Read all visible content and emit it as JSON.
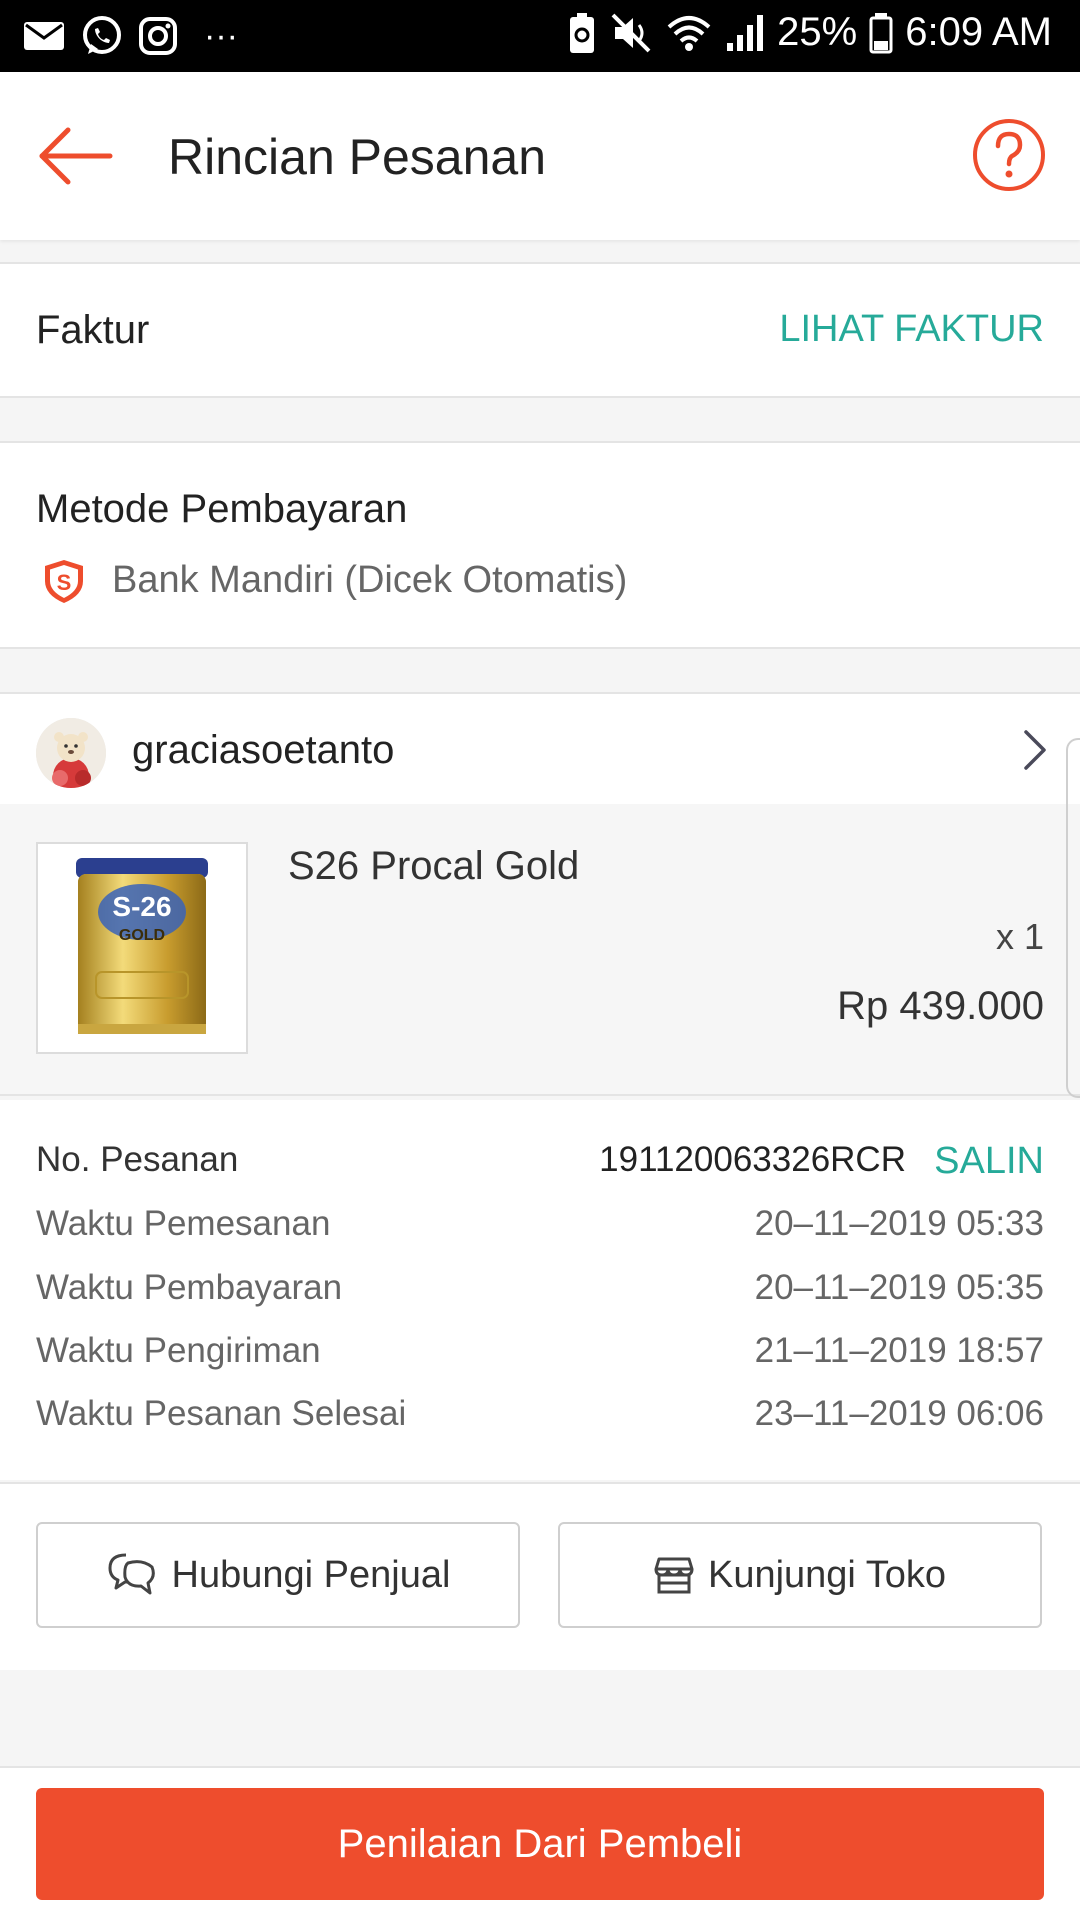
{
  "status_bar": {
    "battery": "25%",
    "time": "6:09 AM",
    "overflow": "···"
  },
  "header": {
    "title": "Rincian Pesanan"
  },
  "invoice": {
    "label": "Faktur",
    "action": "LIHAT FAKTUR"
  },
  "payment": {
    "label": "Metode Pembayaran",
    "method": "Bank Mandiri (Dicek Otomatis)"
  },
  "shop": {
    "name": "graciasoetanto"
  },
  "product": {
    "name": "S26 Procal Gold",
    "quantity": "x 1",
    "price": "Rp 439.000",
    "image_text_brand": "S-26",
    "image_text_sub": "GOLD"
  },
  "order_details": {
    "order_no_label": "No. Pesanan",
    "order_no": "191120063326RCR",
    "copy_label": "SALIN",
    "rows": [
      {
        "label": "Waktu Pemesanan",
        "value": "20–11–2019 05:33"
      },
      {
        "label": "Waktu Pembayaran",
        "value": "20–11–2019 05:35"
      },
      {
        "label": "Waktu Pengiriman",
        "value": "21–11–2019 18:57"
      },
      {
        "label": "Waktu Pesanan Selesai",
        "value": "23–11–2019 06:06"
      }
    ]
  },
  "actions": {
    "contact_seller": "Hubungi Penjual",
    "visit_shop": "Kunjungi Toko"
  },
  "bottom": {
    "rate_button": "Penilaian Dari Pembeli"
  },
  "colors": {
    "accent": "#ee4d2d",
    "link": "#26aa99"
  }
}
